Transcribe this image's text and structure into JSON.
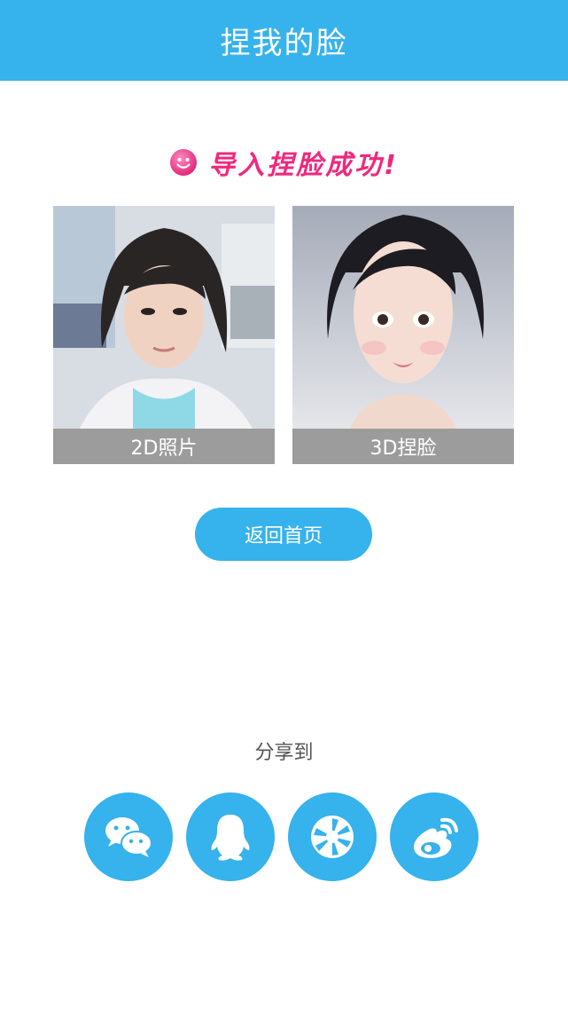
{
  "header": {
    "title": "捏我的脸"
  },
  "status": {
    "message": "导入捏脸成功!"
  },
  "photos": {
    "photo_2d_label": "2D照片",
    "photo_3d_label": "3D捏脸"
  },
  "actions": {
    "home_label": "返回首页"
  },
  "share": {
    "label": "分享到",
    "targets": [
      {
        "icon": "wechat-icon"
      },
      {
        "icon": "qq-icon"
      },
      {
        "icon": "moments-icon"
      },
      {
        "icon": "weibo-icon"
      }
    ]
  },
  "colors": {
    "accent": "#36b2ec",
    "success_text": "#f0287d",
    "caption_bg": "#9c9c9c"
  }
}
